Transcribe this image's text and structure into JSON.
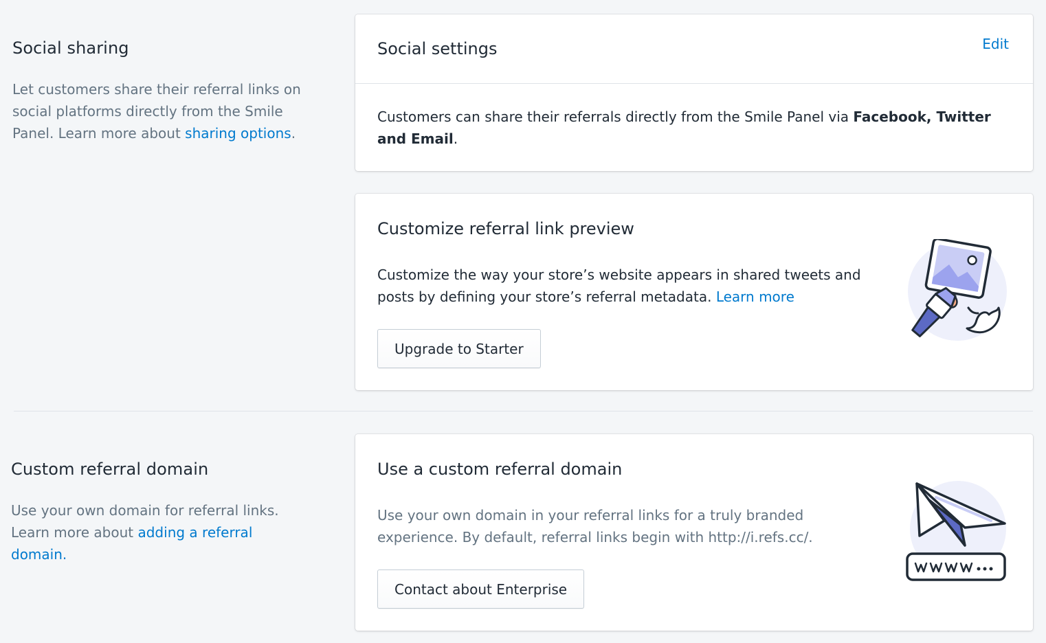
{
  "social_sharing": {
    "title": "Social sharing",
    "desc_prefix": "Let customers share their referral links on social platforms directly from the Smile Panel. Learn more about ",
    "desc_link": "sharing options",
    "desc_suffix": "."
  },
  "social_settings_card": {
    "title": "Social settings",
    "edit_label": "Edit",
    "text_prefix": "Customers can share their referrals directly from the Smile Panel via ",
    "text_bold": "Facebook, Twitter and Email",
    "text_suffix": "."
  },
  "link_preview_card": {
    "title": "Customize referral link preview",
    "text": "Customize the way your store’s website appears in shared tweets and posts by defining your store’s referral metadata. ",
    "link": "Learn more",
    "button_label": "Upgrade to Starter",
    "illustration_icon": "paintbrush-image-illustration"
  },
  "custom_domain": {
    "title": "Custom referral domain",
    "desc_prefix": "Use your own domain for referral links. Learn more about ",
    "desc_link": "adding a referral domain.",
    "desc_suffix": ""
  },
  "custom_domain_card": {
    "title": "Use a custom referral domain",
    "text": "Use your own domain in your referral links for a truly branded experience. By default, referral links begin with http://i.refs.cc/.",
    "button_label": "Contact about Enterprise",
    "illustration_icon": "paper-plane-url-illustration"
  },
  "colors": {
    "background": "#f4f6f8",
    "link": "#007ace",
    "text": "#212b36",
    "muted": "#637381",
    "illustration_accent": "#5c6ac4"
  }
}
